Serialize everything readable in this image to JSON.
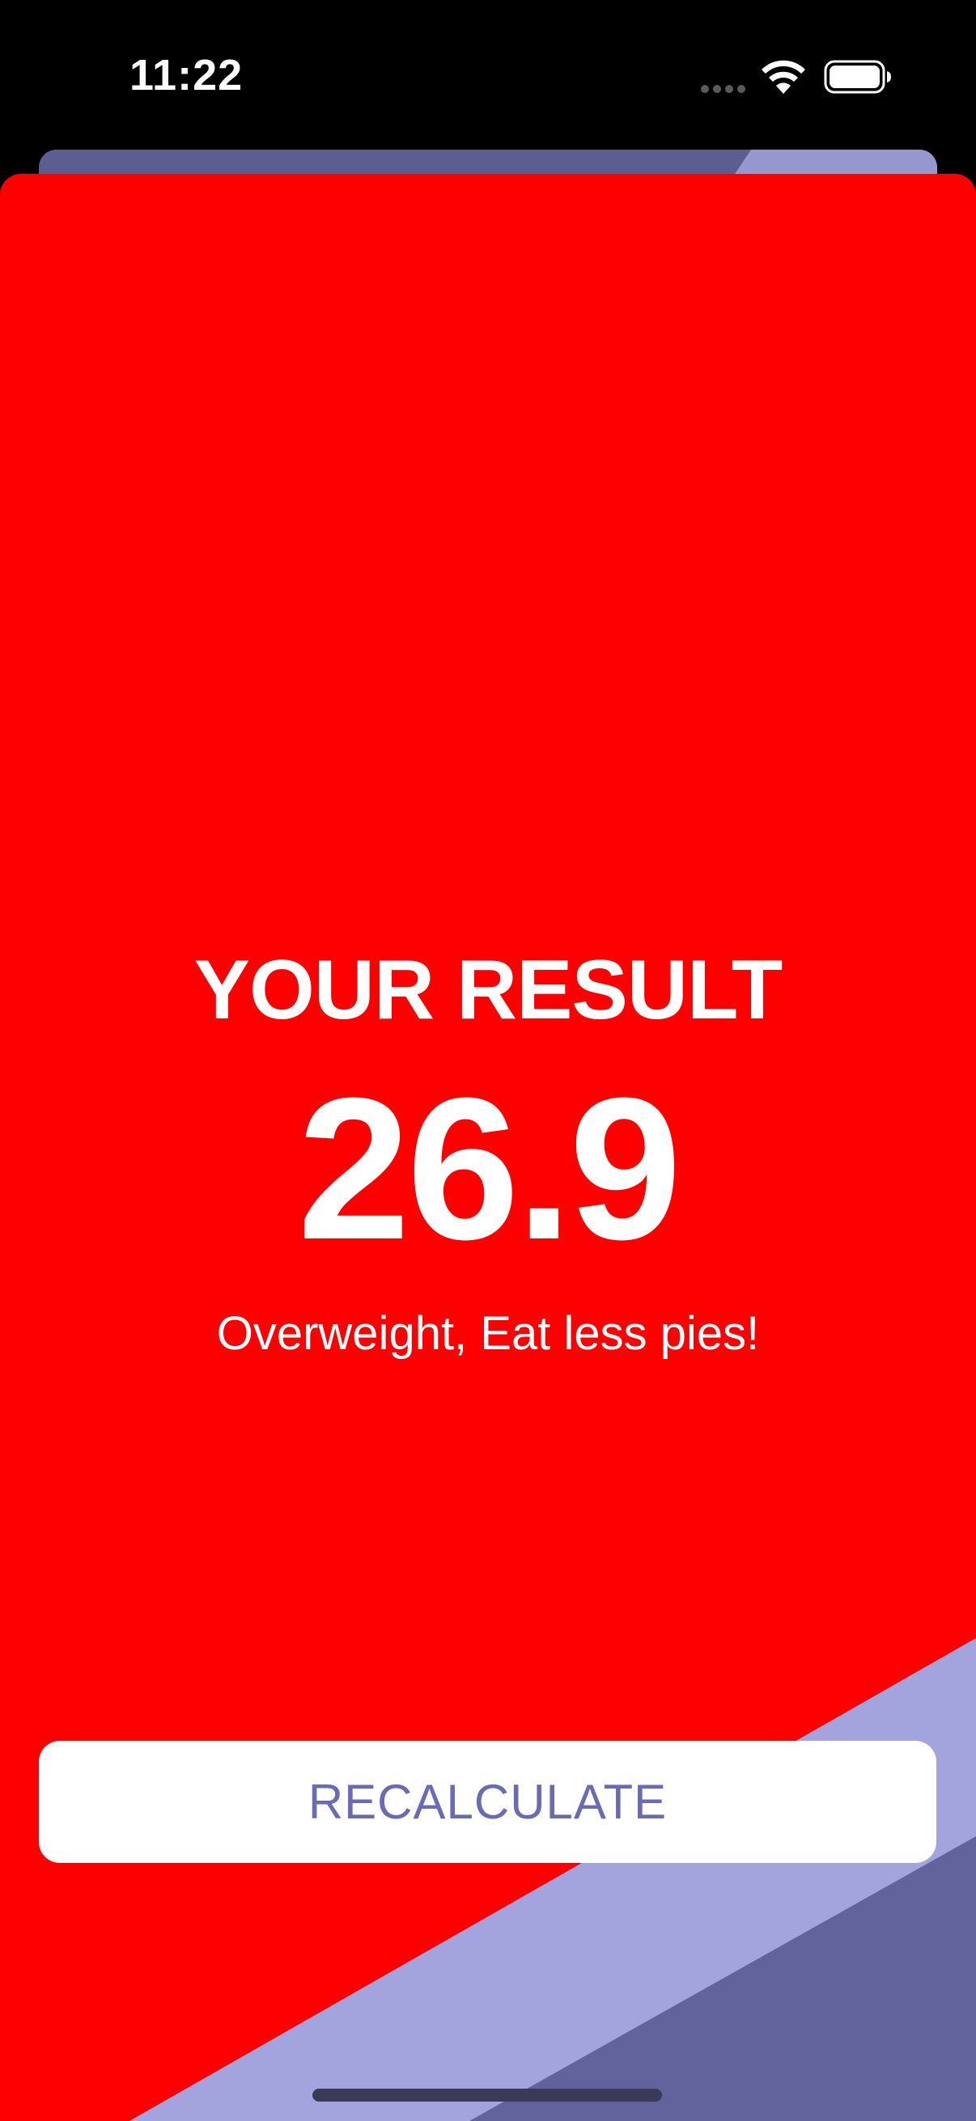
{
  "status_bar": {
    "time": "11:22",
    "icons": [
      "signal-dots-icon",
      "wifi-icon",
      "battery-icon"
    ]
  },
  "result": {
    "title": "YOUR RESULT",
    "value": "26.9",
    "message": "Overweight, Eat less pies!"
  },
  "actions": {
    "recalculate_label": "RECALCULATE"
  },
  "colors": {
    "sheet_background": "#fe0000",
    "accent_light": "#a3a3de",
    "accent_dark": "#62639d",
    "button_text": "#6a6bb8",
    "button_background": "#ffffff"
  }
}
